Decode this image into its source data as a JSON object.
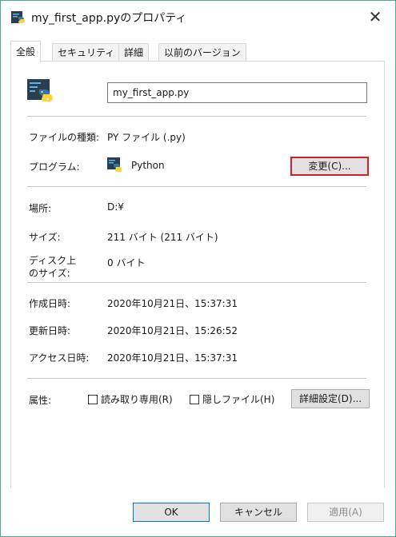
{
  "window": {
    "title": "my_first_app.pyのプロパティ",
    "close_glyph": "✕"
  },
  "tabs": [
    {
      "label": "全般",
      "active": true
    },
    {
      "label": "セキュリティ",
      "active": false
    },
    {
      "label": "詳細",
      "active": false
    },
    {
      "label": "以前のバージョン",
      "active": false
    }
  ],
  "general": {
    "filename": "my_first_app.py",
    "file_type_label": "ファイルの種類:",
    "file_type_value": "PY ファイル (.py)",
    "program_label": "プログラム:",
    "program_value": "Python",
    "change_button": "変更(C)...",
    "location_label": "場所:",
    "location_value": "D:¥",
    "size_label": "サイズ:",
    "size_value": "211 バイト (211 バイト)",
    "disk_size_label_1": "ディスク上",
    "disk_size_label_2": "のサイズ:",
    "disk_size_value": "0 バイト",
    "created_label": "作成日時:",
    "created_value": "2020年10月21日、15:37:31",
    "modified_label": "更新日時:",
    "modified_value": "2020年10月21日、15:26:52",
    "accessed_label": "アクセス日時:",
    "accessed_value": "2020年10月21日、15:37:31",
    "attributes_label": "属性:",
    "readonly_label": "読み取り専用(R)",
    "hidden_label": "隠しファイル(H)",
    "advanced_button": "詳細設定(D)..."
  },
  "footer": {
    "ok": "OK",
    "cancel": "キャンセル",
    "apply": "適用(A)"
  },
  "icons": {
    "title": "python-file-icon",
    "file": "python-file-icon",
    "program": "python-logo-icon",
    "close": "close-icon"
  },
  "colors": {
    "window_border": "#4cae8b",
    "highlight_border": "#d0202a",
    "ok_border": "#0078d7"
  }
}
